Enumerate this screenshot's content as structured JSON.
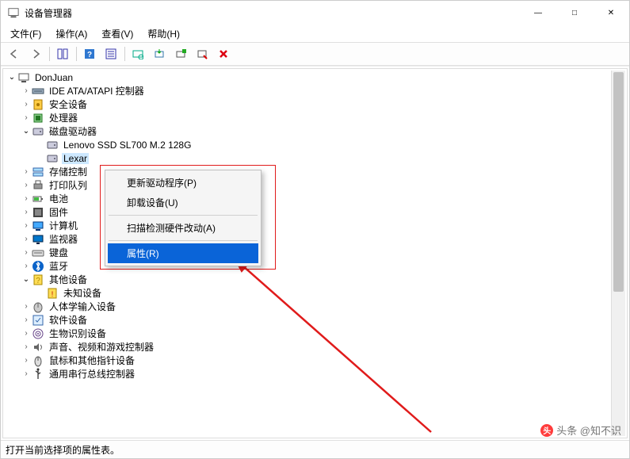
{
  "window": {
    "title": "设备管理器",
    "controls": {
      "min": "—",
      "max": "□",
      "close": "✕"
    }
  },
  "menubar": {
    "file": "文件(F)",
    "action": "操作(A)",
    "view": "查看(V)",
    "help": "帮助(H)"
  },
  "toolbar_icons": [
    "back-icon",
    "forward-icon",
    "show-hide-icon",
    "help-icon",
    "properties-icon",
    "refresh-icon",
    "update-driver-icon",
    "uninstall-icon",
    "disable-icon",
    "stop-icon"
  ],
  "tree": {
    "root": {
      "label": "DonJuan",
      "expanded": true
    },
    "nodes": [
      {
        "label": "IDE ATA/ATAPI 控制器",
        "icon": "ide-icon",
        "expanded": false,
        "hasChildren": true,
        "indent": 1
      },
      {
        "label": "安全设备",
        "icon": "security-device-icon",
        "expanded": false,
        "hasChildren": true,
        "indent": 1
      },
      {
        "label": "处理器",
        "icon": "cpu-icon",
        "expanded": false,
        "hasChildren": true,
        "indent": 1
      },
      {
        "label": "磁盘驱动器",
        "icon": "disk-icon",
        "expanded": true,
        "hasChildren": true,
        "indent": 1
      },
      {
        "label": "Lenovo SSD SL700 M.2 128G",
        "icon": "disk-item-icon",
        "expanded": false,
        "hasChildren": false,
        "indent": 2
      },
      {
        "label": "Lexar",
        "icon": "disk-item-icon",
        "expanded": false,
        "hasChildren": false,
        "indent": 2,
        "selected": true
      },
      {
        "label": "存储控制",
        "icon": "storage-ctrl-icon",
        "expanded": false,
        "hasChildren": true,
        "indent": 1
      },
      {
        "label": "打印队列",
        "icon": "printer-icon",
        "expanded": false,
        "hasChildren": true,
        "indent": 1
      },
      {
        "label": "电池",
        "icon": "battery-icon",
        "expanded": false,
        "hasChildren": true,
        "indent": 1
      },
      {
        "label": "固件",
        "icon": "firmware-icon",
        "expanded": false,
        "hasChildren": true,
        "indent": 1
      },
      {
        "label": "计算机",
        "icon": "computer-icon",
        "expanded": false,
        "hasChildren": true,
        "indent": 1
      },
      {
        "label": "监视器",
        "icon": "monitor-icon",
        "expanded": false,
        "hasChildren": true,
        "indent": 1
      },
      {
        "label": "键盘",
        "icon": "keyboard-icon",
        "expanded": false,
        "hasChildren": true,
        "indent": 1
      },
      {
        "label": "蓝牙",
        "icon": "bluetooth-icon",
        "expanded": false,
        "hasChildren": true,
        "indent": 1
      },
      {
        "label": "其他设备",
        "icon": "other-device-icon",
        "expanded": true,
        "hasChildren": true,
        "indent": 1
      },
      {
        "label": "未知设备",
        "icon": "unknown-device-icon",
        "expanded": false,
        "hasChildren": false,
        "indent": 2
      },
      {
        "label": "人体学输入设备",
        "icon": "hid-icon",
        "expanded": false,
        "hasChildren": true,
        "indent": 1
      },
      {
        "label": "软件设备",
        "icon": "software-device-icon",
        "expanded": false,
        "hasChildren": true,
        "indent": 1
      },
      {
        "label": "生物识别设备",
        "icon": "biometric-icon",
        "expanded": false,
        "hasChildren": true,
        "indent": 1
      },
      {
        "label": "声音、视频和游戏控制器",
        "icon": "sound-icon",
        "expanded": false,
        "hasChildren": true,
        "indent": 1
      },
      {
        "label": "鼠标和其他指针设备",
        "icon": "mouse-icon",
        "expanded": false,
        "hasChildren": true,
        "indent": 1
      },
      {
        "label": "通用串行总线控制器",
        "icon": "usb-icon",
        "expanded": false,
        "hasChildren": true,
        "indent": 1
      }
    ]
  },
  "context_menu": {
    "items": [
      {
        "label": "更新驱动程序(P)",
        "highlight": false
      },
      {
        "label": "卸载设备(U)",
        "highlight": false
      },
      {
        "sep": true
      },
      {
        "label": "扫描检测硬件改动(A)",
        "highlight": false
      },
      {
        "sep": true
      },
      {
        "label": "属性(R)",
        "highlight": true
      }
    ]
  },
  "statusbar": {
    "text": "打开当前选择项的属性表。"
  },
  "watermark": {
    "text": "头条 @知不识"
  },
  "colors": {
    "annotation": "#e01b1b",
    "menu_highlight": "#0a64d8"
  }
}
